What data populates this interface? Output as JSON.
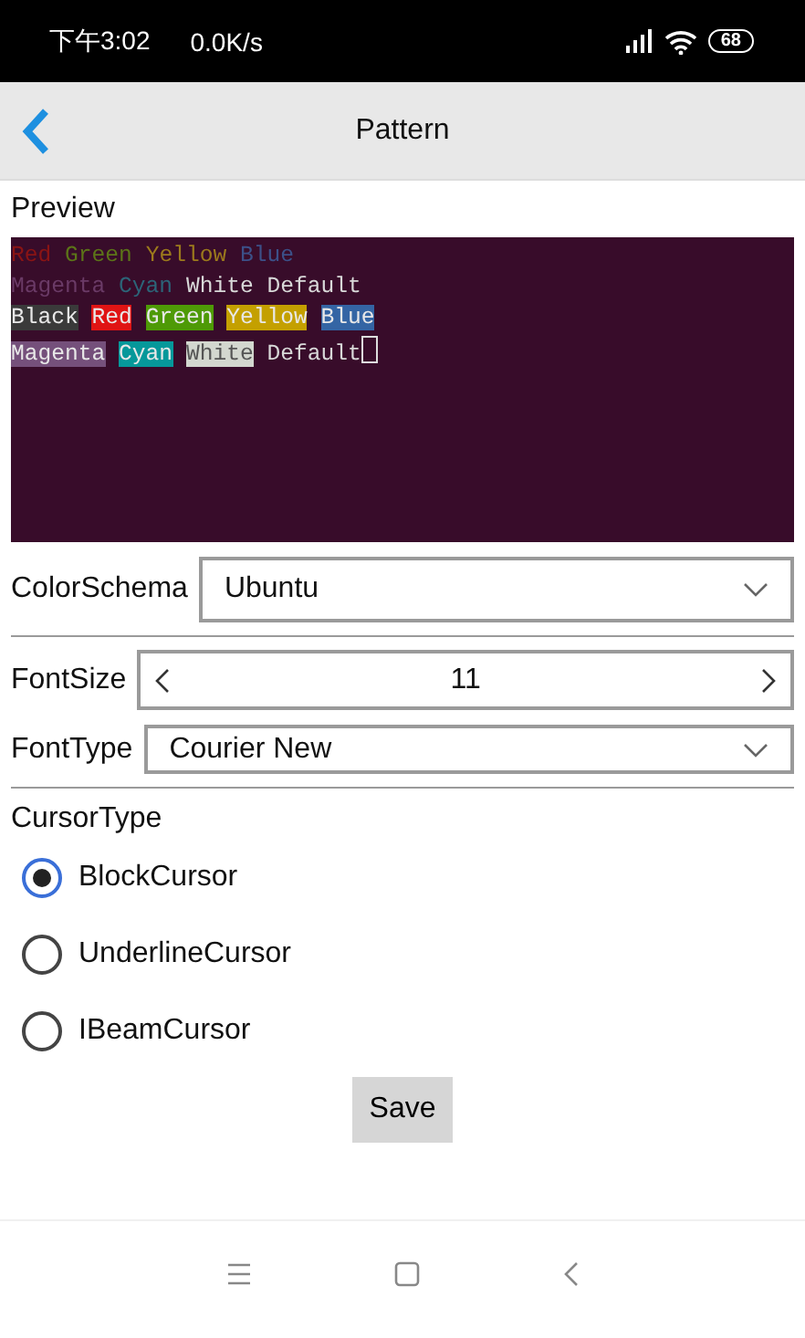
{
  "status_bar": {
    "time": "下午3:02",
    "speed": "0.0K/s",
    "battery": "68"
  },
  "header": {
    "title": "Pattern"
  },
  "preview": {
    "label": "Preview",
    "cursor": true,
    "lines": [
      [
        {
          "text": "Red",
          "kind": "plain",
          "color": "#8a1414"
        },
        {
          "text": "Green",
          "kind": "plain",
          "color": "#5c7418"
        },
        {
          "text": "Yellow",
          "kind": "plain",
          "color": "#9c7a1c"
        },
        {
          "text": "Blue",
          "kind": "plain",
          "color": "#3c5088"
        }
      ],
      [
        {
          "text": "Magenta",
          "kind": "plain",
          "color": "#6a3a66"
        },
        {
          "text": "Cyan",
          "kind": "plain",
          "color": "#2c6478"
        },
        {
          "text": "White",
          "kind": "plain",
          "color": "#d8d8d8"
        },
        {
          "text": "Default",
          "kind": "plain",
          "color": "#d8d8d8"
        }
      ],
      [
        {
          "text": "Black",
          "kind": "highlight",
          "color": "#3a3a3a"
        },
        {
          "text": "Red",
          "kind": "highlight",
          "color": "#e01414"
        },
        {
          "text": "Green",
          "kind": "highlight",
          "color": "#4e9a06"
        },
        {
          "text": "Yellow",
          "kind": "highlight",
          "color": "#c4a000"
        },
        {
          "text": "Blue",
          "kind": "highlight",
          "color": "#3465a4"
        }
      ],
      [
        {
          "text": "Magenta",
          "kind": "highlight",
          "color": "#75507b"
        },
        {
          "text": "Cyan",
          "kind": "highlight",
          "color": "#06989a"
        },
        {
          "text": "White",
          "kind": "highlight",
          "color": "#d3d7cf"
        },
        {
          "text": "Default",
          "kind": "plain",
          "color": "#d8d8d8"
        }
      ]
    ]
  },
  "color_schema": {
    "label": "ColorSchema",
    "value": "Ubuntu"
  },
  "font_size": {
    "label": "FontSize",
    "value": "11"
  },
  "font_type": {
    "label": "FontType",
    "value": "Courier New"
  },
  "cursor_type": {
    "label": "CursorType",
    "options": [
      {
        "label": "BlockCursor",
        "selected": true
      },
      {
        "label": "UnderlineCursor",
        "selected": false
      },
      {
        "label": "IBeamCursor",
        "selected": false
      }
    ]
  },
  "save_button": "Save"
}
